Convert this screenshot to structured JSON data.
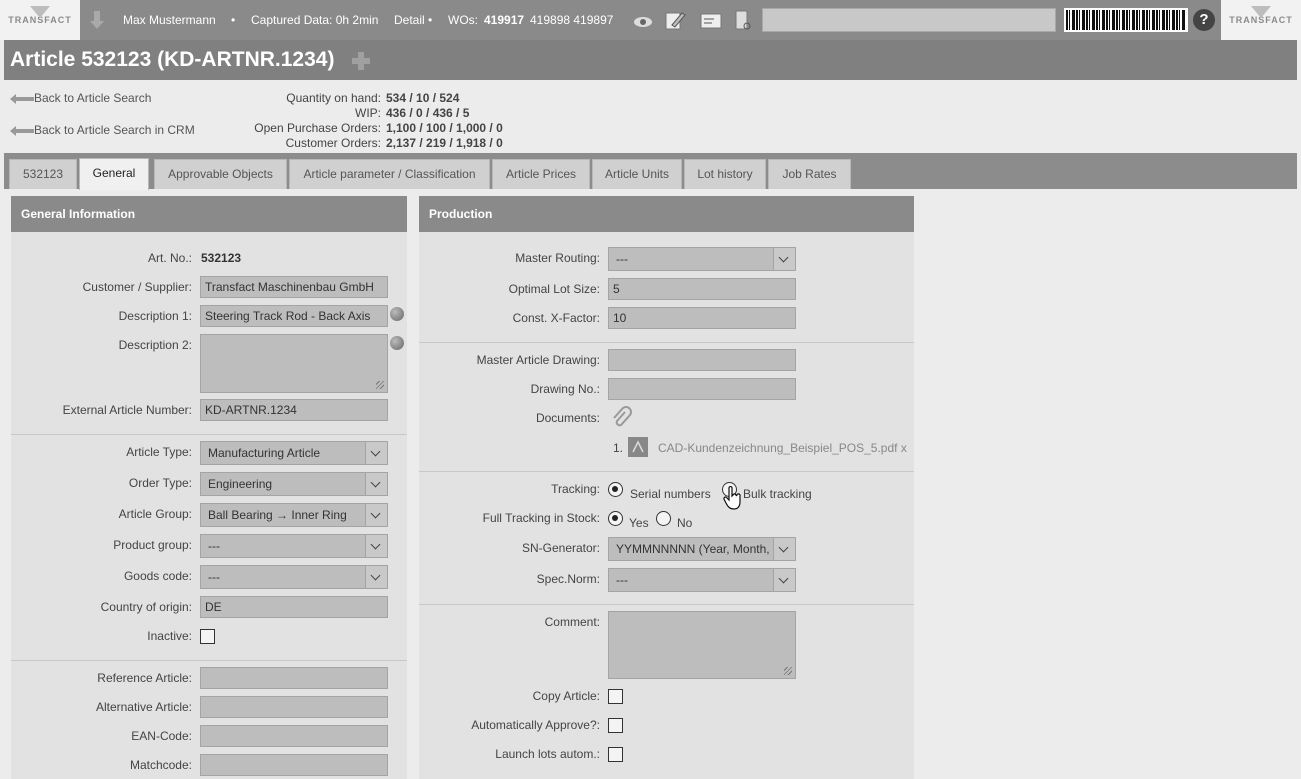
{
  "topbar": {
    "logo_text": "TRANSFACT",
    "user": "Max Mustermann",
    "separator": "•",
    "captured": "Captured Data: 0h 2min",
    "detail": "Detail •",
    "wos_label": "WOs:",
    "wo_active": "419917",
    "wo_others": "419898 419897",
    "help": "?"
  },
  "header": {
    "title": "Article 532123 (KD-ARTNR.1234)"
  },
  "links": {
    "back_search": "Back to Article Search",
    "back_crm": "Back to Article Search in CRM"
  },
  "summary": [
    {
      "label": "Quantity on hand:",
      "value": "534 / 10 / 524"
    },
    {
      "label": "WIP:",
      "value": "436 / 0 / 436 / 5"
    },
    {
      "label": "Open Purchase Orders:",
      "value": "1,100 / 100 / 1,000 / 0"
    },
    {
      "label": "Customer Orders:",
      "value": "2,137 / 219 / 1,918 / 0"
    }
  ],
  "tabs": [
    {
      "label": "532123"
    },
    {
      "label": "General"
    },
    {
      "label": "Approvable Objects"
    },
    {
      "label": "Article parameter / Classification"
    },
    {
      "label": "Article Prices"
    },
    {
      "label": "Article Units"
    },
    {
      "label": "Lot history"
    },
    {
      "label": "Job Rates"
    }
  ],
  "general": {
    "heading": "General Information",
    "art_no_label": "Art. No.:",
    "art_no": "532123",
    "customer_label": "Customer / Supplier:",
    "customer": "Transfact Maschinenbau GmbH",
    "desc1_label": "Description 1:",
    "desc1": "Steering Track Rod - Back Axis",
    "desc2_label": "Description 2:",
    "ext_label": "External Article Number:",
    "ext": "KD-ARTNR.1234",
    "type_label": "Article Type:",
    "type": "Manufacturing Article",
    "order_label": "Order Type:",
    "order": "Engineering",
    "group_label": "Article Group:",
    "group": "Ball Bearing → Inner Ring",
    "product_label": "Product group:",
    "product": "---",
    "goods_label": "Goods code:",
    "goods": "---",
    "country_label": "Country of origin:",
    "country": "DE",
    "inactive_label": "Inactive:",
    "ref_label": "Reference Article:",
    "alt_label": "Alternative Article:",
    "ean_label": "EAN-Code:",
    "match_label": "Matchcode:"
  },
  "production": {
    "heading": "Production",
    "routing_label": "Master Routing:",
    "routing": "---",
    "lot_label": "Optimal Lot Size:",
    "lot": "5",
    "xfactor_label": "Const. X-Factor:",
    "xfactor": "10",
    "drawing_label": "Master Article Drawing:",
    "drawno_label": "Drawing No.:",
    "docs_label": "Documents:",
    "doc_index": "1.",
    "doc_name": "CAD-Kundenzeichnung_Beispiel_POS_5.pdf x",
    "tracking_label": "Tracking:",
    "tracking_serial": "Serial numbers",
    "tracking_bulk": "Bulk tracking",
    "full_label": "Full Tracking in Stock:",
    "yes": "Yes",
    "no": "No",
    "sn_label": "SN-Generator:",
    "sn": "YYMMNNNNN (Year, Month, N",
    "spec_label": "Spec.Norm:",
    "spec": "---",
    "comment_label": "Comment:",
    "copy_label": "Copy Article:",
    "approve_label": "Automatically Approve?:",
    "launch_label": "Launch lots autom.:"
  }
}
